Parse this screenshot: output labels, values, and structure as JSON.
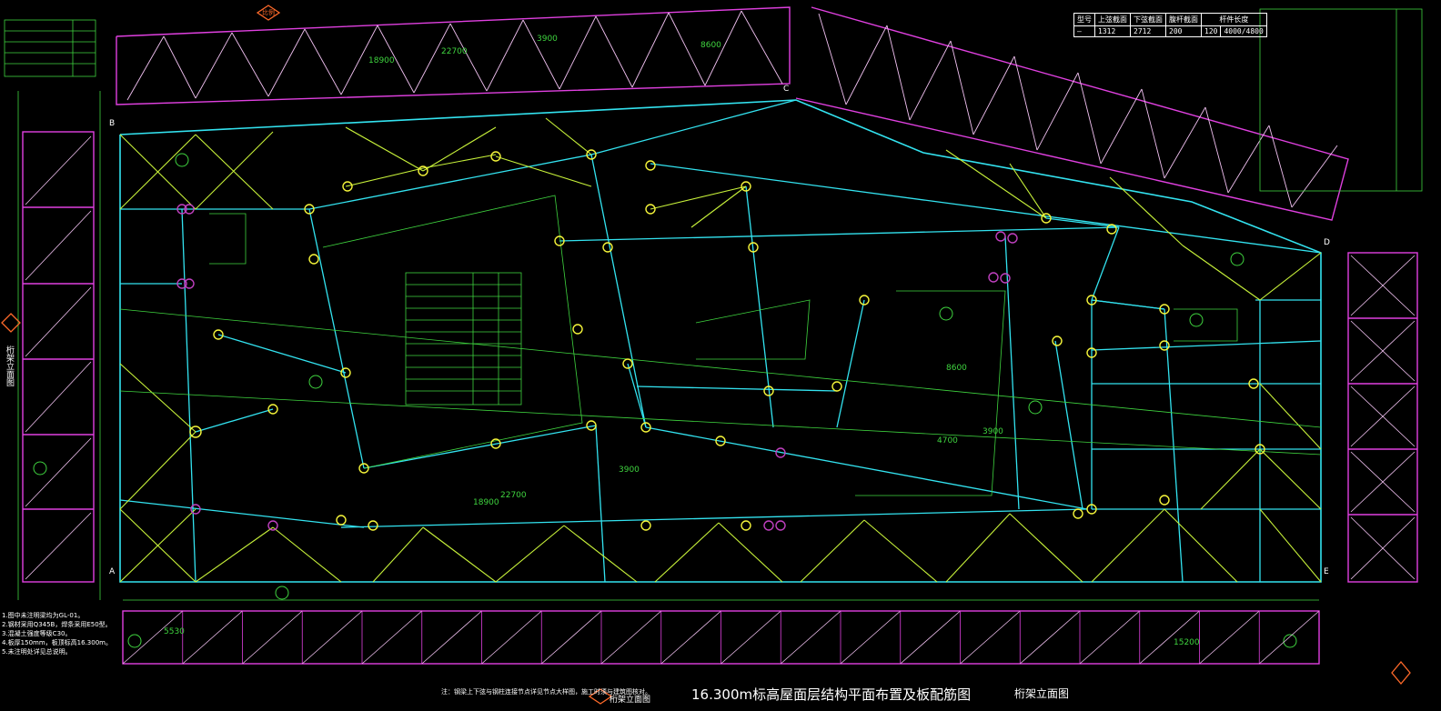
{
  "titles": {
    "main": "16.300m标高屋面层结构平面布置及板配筋图",
    "truss_elev": "桁架立面图",
    "left_elev": "桁架立面图",
    "bottom_elev": "桁架立面图"
  },
  "axes": {
    "A": "A",
    "B": "B",
    "C": "C",
    "D": "D",
    "E": "E"
  },
  "dims": {
    "d1": "22700",
    "d2": "18900",
    "d3": "3900",
    "d4": "8600",
    "d5": "22700",
    "d6": "18900",
    "d7": "3900",
    "d8": "5530",
    "d9": "15200",
    "d10": "3900",
    "d11": "8600",
    "d12": "4700"
  },
  "table": {
    "headers": [
      "型号",
      "上弦截面",
      "下弦截面",
      "腹杆截面",
      "杆件长度"
    ],
    "row": [
      "—",
      "1312",
      "2712",
      "200",
      "120",
      "4000/4800"
    ]
  },
  "notes": [
    "1.图中未注明梁均为GL-01。",
    "2.钢材采用Q345B，焊条采用E50型。",
    "3.混凝土强度等级C30。",
    "4.板厚150mm，板顶标高16.300m。",
    "5.未注明处详见总说明。"
  ],
  "bottom_note": "注：钢梁上下弦与钢柱连接节点详见节点大样图，施工时须与建筑图核对。",
  "scale_tag": "比例",
  "colors": {
    "beam": "#33e3f0",
    "brace": "#c8f23a",
    "truss": "#e040e0",
    "grid": "#3fd43f",
    "col": "#f5f53a",
    "pin": "#c040c0"
  }
}
